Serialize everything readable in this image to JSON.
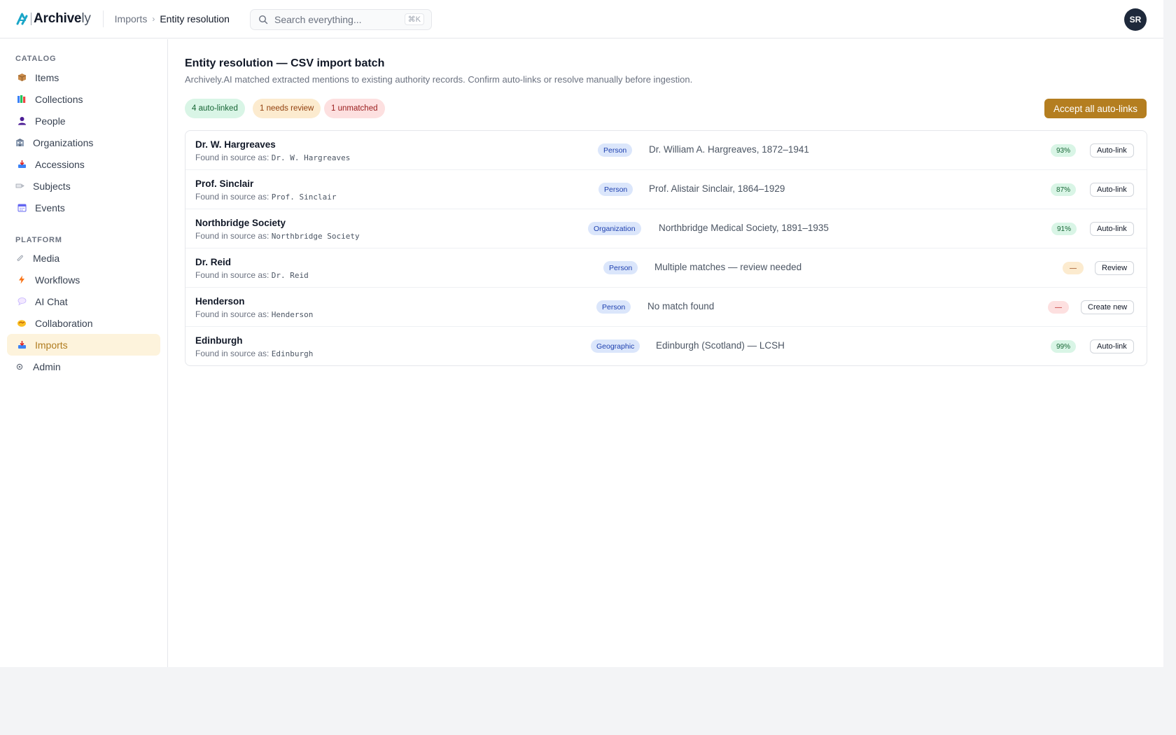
{
  "app": {
    "logo_text_bold": "Archive",
    "logo_text_light": "ly",
    "logo_icon": "archively-logo-mark",
    "accent_color": "#b47e20"
  },
  "header": {
    "breadcrumb": [
      "Imports",
      "Entity resolution"
    ],
    "search_placeholder": "Search everything...",
    "search_shortcut": "⌘K",
    "user_initials": "SR"
  },
  "sidebar": {
    "catalog_label": "CATALOG",
    "catalog_items": [
      {
        "label": "Items",
        "icon": "package-icon"
      },
      {
        "label": "Collections",
        "icon": "books-icon"
      },
      {
        "label": "People",
        "icon": "person-icon"
      },
      {
        "label": "Organizations",
        "icon": "building-icon"
      },
      {
        "label": "Accessions",
        "icon": "inbox-tray-icon"
      },
      {
        "label": "Subjects",
        "icon": "tag-icon"
      },
      {
        "label": "Events",
        "icon": "calendar-icon"
      }
    ],
    "platform_label": "PLATFORM",
    "platform_items": [
      {
        "label": "Media",
        "icon": "paperclip-icon"
      },
      {
        "label": "Workflows",
        "icon": "lightning-icon"
      },
      {
        "label": "AI Chat",
        "icon": "speech-bubble-icon"
      },
      {
        "label": "Collaboration",
        "icon": "handshake-icon"
      },
      {
        "label": "Imports",
        "icon": "inbox-tray-icon",
        "active": true
      },
      {
        "label": "Admin",
        "icon": "gear-icon"
      }
    ]
  },
  "main": {
    "title": "Entity resolution — CSV import batch",
    "subtitle": "Archively.AI matched extracted mentions to existing authority records. Confirm auto-links or resolve manually before ingestion.",
    "summary": {
      "auto_linked": "4 auto-linked",
      "needs_review": "1 needs review",
      "unmatched": "1 unmatched"
    },
    "accept_all_label": "Accept all auto-links",
    "found_prefix": "Found in source as:",
    "rows": [
      {
        "name": "Dr. W. Hargreaves",
        "source": "Dr. W. Hargreaves",
        "type": "Person",
        "match": "Dr. William A. Hargreaves, 1872–1941",
        "confidence": "93%",
        "status": "green",
        "action": "Auto-link"
      },
      {
        "name": "Prof. Sinclair",
        "source": "Prof. Sinclair",
        "type": "Person",
        "match": "Prof. Alistair Sinclair, 1864–1929",
        "confidence": "87%",
        "status": "green",
        "action": "Auto-link"
      },
      {
        "name": "Northbridge Society",
        "source": "Northbridge Society",
        "type": "Organization",
        "match": "Northbridge Medical Society, 1891–1935",
        "confidence": "91%",
        "status": "green",
        "action": "Auto-link"
      },
      {
        "name": "Dr. Reid",
        "source": "Dr. Reid",
        "type": "Person",
        "match": "Multiple matches — review needed",
        "confidence": "—",
        "status": "amber",
        "action": "Review"
      },
      {
        "name": "Henderson",
        "source": "Henderson",
        "type": "Person",
        "match": "No match found",
        "confidence": "—",
        "status": "red",
        "action": "Create new"
      },
      {
        "name": "Edinburgh",
        "source": "Edinburgh",
        "type": "Geographic",
        "match": "Edinburgh (Scotland) — LCSH",
        "confidence": "99%",
        "status": "green",
        "action": "Auto-link"
      }
    ]
  }
}
